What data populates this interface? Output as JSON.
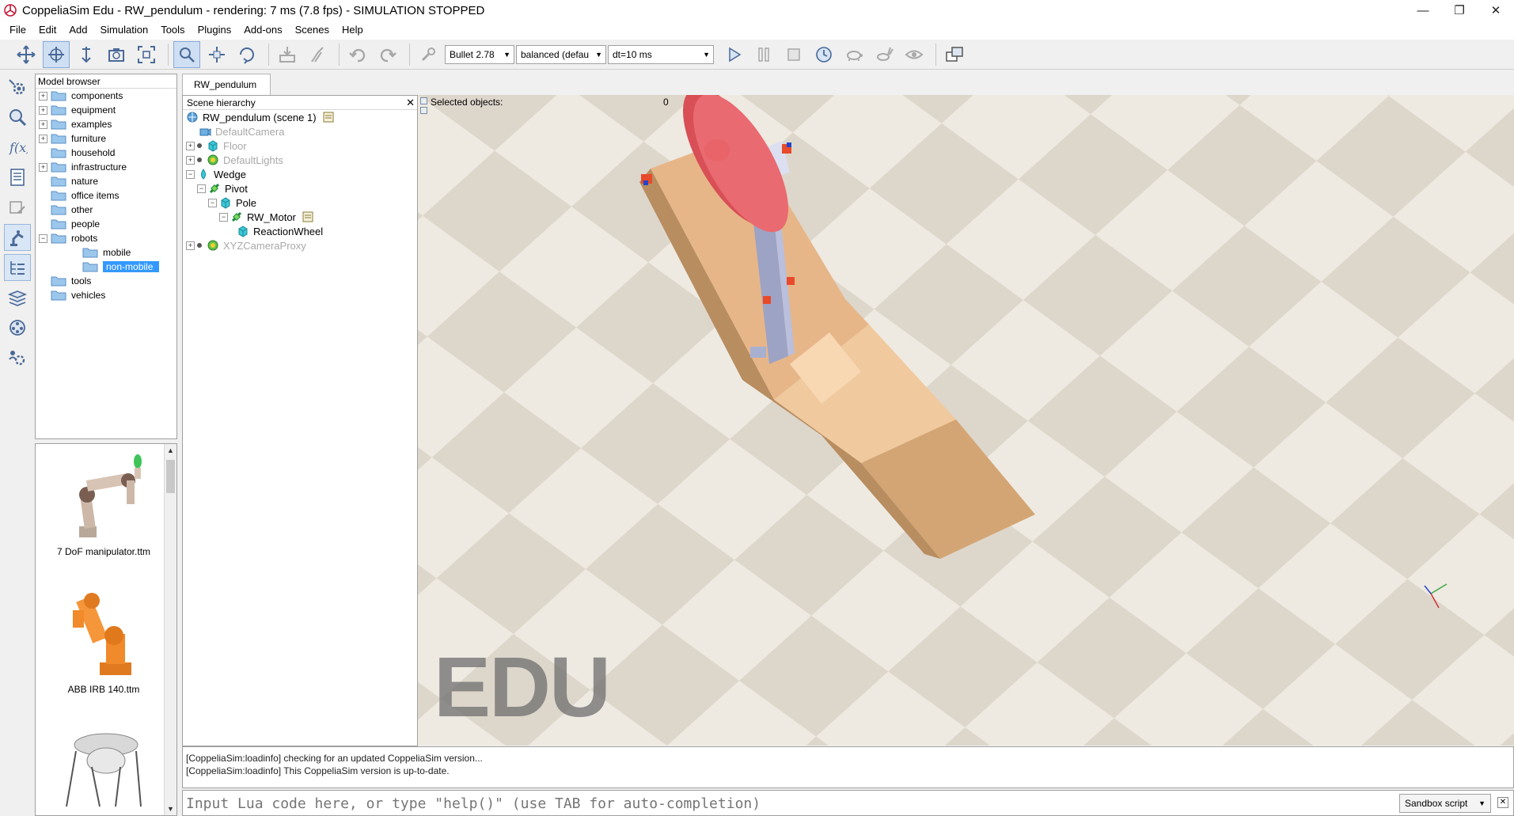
{
  "window": {
    "title": "CoppeliaSim Edu - RW_pendulum - rendering: 7 ms (7.8 fps) - SIMULATION STOPPED",
    "minimize": "—",
    "restore": "❐",
    "close": "✕"
  },
  "menu": [
    "File",
    "Edit",
    "Add",
    "Simulation",
    "Tools",
    "Plugins",
    "Add-ons",
    "Scenes",
    "Help"
  ],
  "toolbar": {
    "engine": "Bullet 2.78",
    "accuracy": "balanced (defau",
    "timestep": "dt=10 ms",
    "combo_arrow": "▼"
  },
  "model_browser": {
    "title": "Model browser",
    "items": [
      {
        "label": "components",
        "expander": "+"
      },
      {
        "label": "equipment",
        "expander": "+"
      },
      {
        "label": "examples",
        "expander": "+"
      },
      {
        "label": "furniture",
        "expander": "+"
      },
      {
        "label": "household",
        "expander": ""
      },
      {
        "label": "infrastructure",
        "expander": "+"
      },
      {
        "label": "nature",
        "expander": ""
      },
      {
        "label": "office items",
        "expander": ""
      },
      {
        "label": "other",
        "expander": ""
      },
      {
        "label": "people",
        "expander": ""
      },
      {
        "label": "robots",
        "expander": "−"
      },
      {
        "label": "mobile",
        "expander": ""
      },
      {
        "label": "non-mobile",
        "expander": ""
      },
      {
        "label": "tools",
        "expander": ""
      },
      {
        "label": "vehicles",
        "expander": ""
      }
    ],
    "thumbnails": [
      "7 DoF manipulator.ttm",
      "ABB IRB 140.ttm"
    ]
  },
  "scene_tab": "RW_pendulum",
  "hierarchy": {
    "title": "Scene hierarchy",
    "close": "✕",
    "items": [
      {
        "label": "RW_pendulum (scene 1)"
      },
      {
        "label": "DefaultCamera"
      },
      {
        "label": "Floor"
      },
      {
        "label": "DefaultLights"
      },
      {
        "label": "Wedge"
      },
      {
        "label": "Pivot"
      },
      {
        "label": "Pole"
      },
      {
        "label": "RW_Motor"
      },
      {
        "label": "ReactionWheel"
      },
      {
        "label": "XYZCameraProxy"
      }
    ]
  },
  "viewport": {
    "selected_label": "Selected objects:",
    "selected_count": "0",
    "watermark": "EDU"
  },
  "console": {
    "lines": [
      "[CoppeliaSim:loadinfo] checking for an updated CoppeliaSim version...",
      "[CoppeliaSim:loadinfo] This CoppeliaSim version is up-to-date."
    ]
  },
  "lua": {
    "placeholder": "Input Lua code here, or type \"help()\" (use TAB for auto-completion)",
    "script_type": "Sandbox script",
    "arrow": "▼",
    "close": "✕"
  }
}
